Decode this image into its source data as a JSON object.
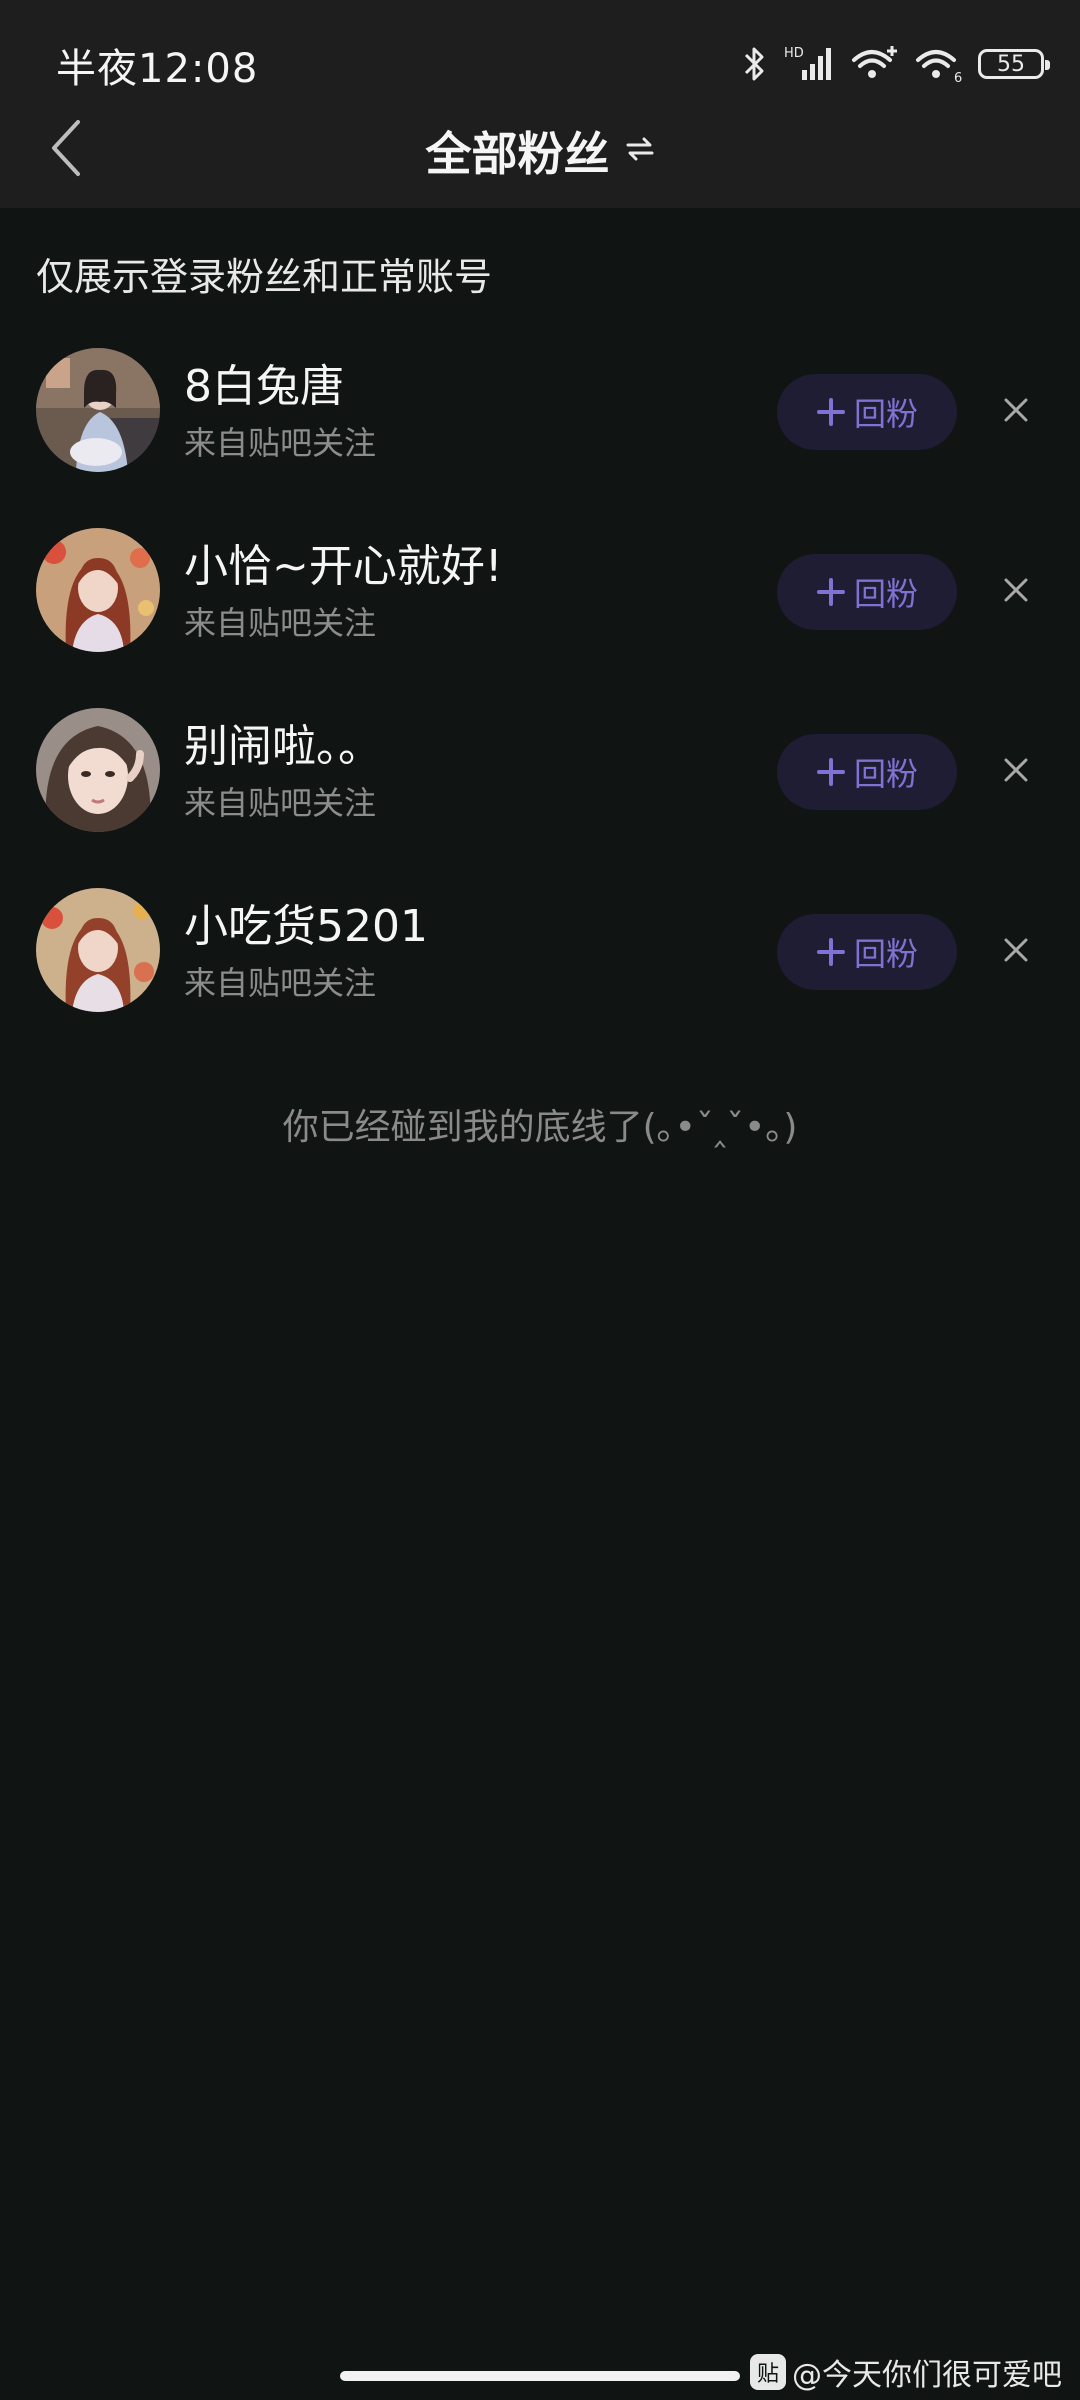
{
  "status_bar": {
    "time": "半夜12:08",
    "network_label": "HD",
    "battery": "55"
  },
  "header": {
    "title": "全部粉丝",
    "back_icon": "chevron-left-icon",
    "switch_icon": "swap-arrows-icon"
  },
  "notice": "仅展示登录粉丝和正常账号",
  "followers": [
    {
      "name": "8白兔唐",
      "source": "来自贴吧关注",
      "follow_label": "回粉"
    },
    {
      "name": "小恰~开心就好!",
      "source": "来自贴吧关注",
      "follow_label": "回粉"
    },
    {
      "name": "别闹啦。。",
      "source": "来自贴吧关注",
      "follow_label": "回粉"
    },
    {
      "name": "小吃货5201",
      "source": "来自贴吧关注",
      "follow_label": "回粉"
    }
  ],
  "end_note": "你已经碰到我的底线了(｡•ˇ‸ˇ•｡)",
  "watermark": {
    "logo_text": "贴",
    "text": "@今天你们很可爱吧"
  },
  "colors": {
    "background": "#101412",
    "header_bg": "#1e1e1e",
    "accent": "#7f72d2",
    "button_bg": "#1e1d33",
    "secondary_text": "#8c8c8c"
  }
}
